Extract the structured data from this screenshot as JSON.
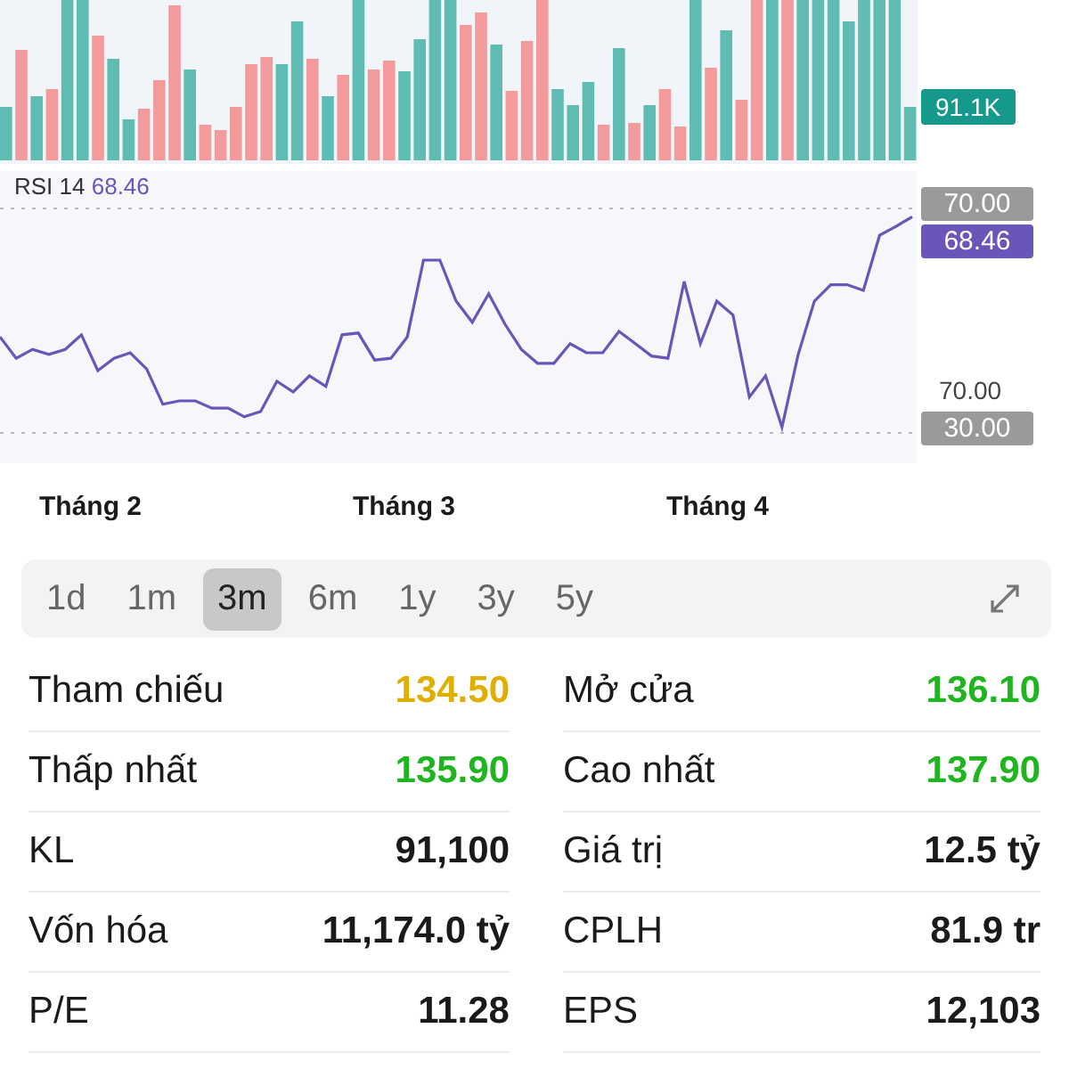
{
  "volume": {
    "last_label": "91.1K"
  },
  "rsi": {
    "value": "68.46",
    "value_badge": "68.46",
    "axis_label": "70.00",
    "chart_data": {
      "type": "line",
      "ylim": [
        30,
        70
      ],
      "yticks": [
        {
          "value": 70,
          "label": "70.00"
        },
        {
          "value": 30,
          "label": "30.00"
        }
      ],
      "series": [
        {
          "name": "RSI 14",
          "color": "#6a55b8",
          "values": [
            47.1,
            43.3,
            44.9,
            44.0,
            44.9,
            47.5,
            41.1,
            43.3,
            44.3,
            41.4,
            35.1,
            35.7,
            35.7,
            34.4,
            34.4,
            32.9,
            33.8,
            39.2,
            37.3,
            40.2,
            38.3,
            47.5,
            47.8,
            43.0,
            43.3,
            47.1,
            60.8,
            60.8,
            53.5,
            49.7,
            54.8,
            49.4,
            44.9,
            42.4,
            42.4,
            45.9,
            44.3,
            44.3,
            48.1,
            45.9,
            43.7,
            43.3,
            57.0,
            45.9,
            53.5,
            51.0,
            36.4,
            40.2,
            31.0,
            44.0,
            53.5,
            56.4,
            56.4,
            55.4,
            65.2,
            66.8,
            68.5
          ]
        }
      ]
    }
  },
  "months": [
    "Tháng 2",
    "Tháng 3",
    "Tháng 4"
  ],
  "periods": [
    {
      "label": "1d",
      "selected": false
    },
    {
      "label": "1m",
      "selected": false
    },
    {
      "label": "3m",
      "selected": true
    },
    {
      "label": "6m",
      "selected": false
    },
    {
      "label": "1y",
      "selected": false
    },
    {
      "label": "3y",
      "selected": false
    },
    {
      "label": "5y",
      "selected": false
    }
  ],
  "stats": [
    {
      "left": {
        "label": "Tham chiếu",
        "value": "134.50",
        "color": "#e0ad00"
      },
      "right": {
        "label": "Mở cửa",
        "value": "136.10",
        "color": "#1fb51f"
      }
    },
    {
      "left": {
        "label": "Thấp nhất",
        "value": "135.90",
        "color": "#1fb51f"
      },
      "right": {
        "label": "Cao nhất",
        "value": "137.90",
        "color": "#1fb51f"
      }
    },
    {
      "left": {
        "label": "KL",
        "value": "91,100",
        "color": "#1a1a1a"
      },
      "right": {
        "label": "Giá trị",
        "value": "12.5 tỷ",
        "color": "#1a1a1a"
      }
    },
    {
      "left": {
        "label": "Vốn hóa",
        "value": "11,174.0 tỷ",
        "color": "#1a1a1a"
      },
      "right": {
        "label": "CPLH",
        "value": "81.9 tr",
        "color": "#1a1a1a"
      }
    },
    {
      "left": {
        "label": "P/E",
        "value": "11.28",
        "color": "#1a1a1a"
      },
      "right": {
        "label": "EPS",
        "value": "12,103",
        "color": "#1a1a1a"
      }
    }
  ]
}
